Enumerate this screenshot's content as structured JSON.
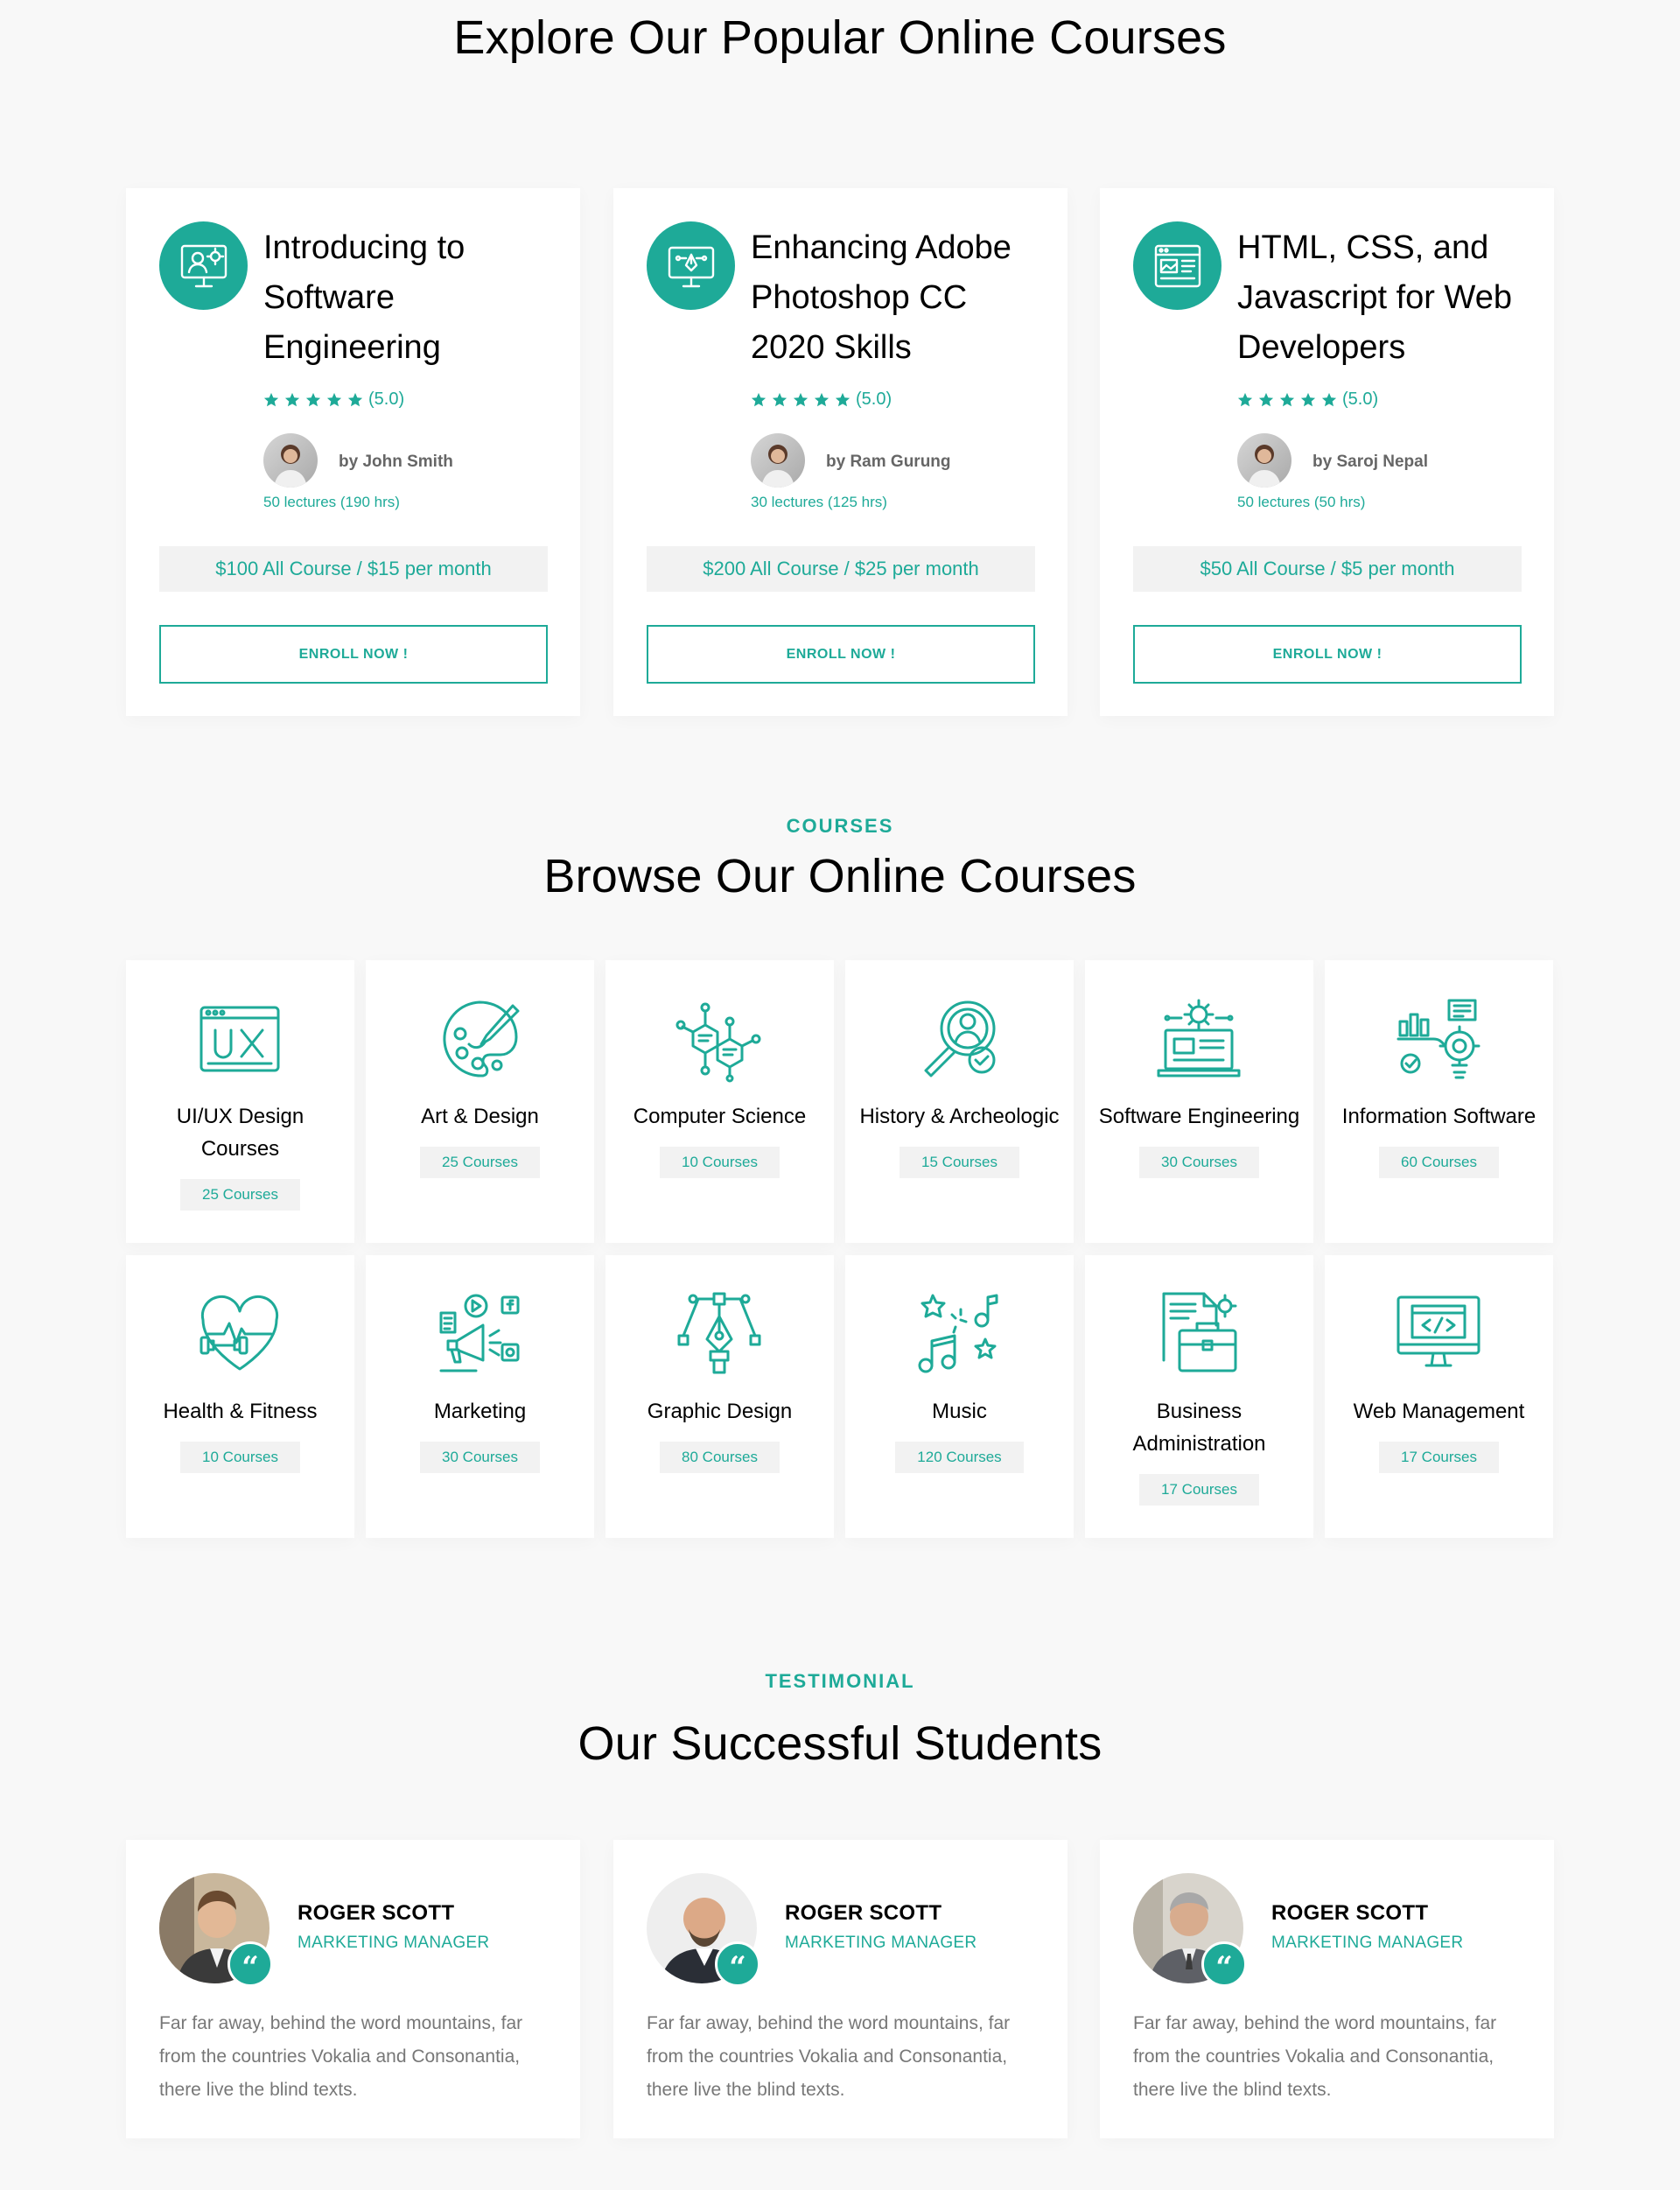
{
  "popular": {
    "title": "Explore Our Popular Online Courses",
    "enroll_label": "ENROLL NOW !",
    "courses": [
      {
        "title": "Introducing to Software Engineering",
        "rating": "(5.0)",
        "author": "by John Smith",
        "lectures": "50 lectures (190 hrs)",
        "price": "$100 All Course / $15 per month",
        "icon": "engineer-gear-icon"
      },
      {
        "title": "Enhancing Adobe Photoshop CC 2020 Skills",
        "rating": "(5.0)",
        "author": "by Ram Gurung",
        "lectures": "30 lectures (125 hrs)",
        "price": "$200 All Course / $25 per month",
        "icon": "monitor-pen-tool-icon"
      },
      {
        "title": "HTML, CSS, and Javascript for Web Developers",
        "rating": "(5.0)",
        "author": "by Saroj Nepal",
        "lectures": "50 lectures (50 hrs)",
        "price": "$50 All Course / $5 per month",
        "icon": "web-layout-icon"
      }
    ]
  },
  "browse": {
    "subtitle": "COURSES",
    "title": "Browse Our Online Courses",
    "categories": [
      {
        "name": "UI/UX Design Courses",
        "count": "25 Courses",
        "icon": "ux-window-icon"
      },
      {
        "name": "Art & Design",
        "count": "25 Courses",
        "icon": "palette-icon"
      },
      {
        "name": "Computer Science",
        "count": "10 Courses",
        "icon": "hexagon-network-icon"
      },
      {
        "name": "History & Archeologic",
        "count": "15 Courses",
        "icon": "magnifier-person-icon"
      },
      {
        "name": "Software Engineering",
        "count": "30 Courses",
        "icon": "laptop-gear-icon"
      },
      {
        "name": "Information Software",
        "count": "60 Courses",
        "icon": "chart-bulb-icon"
      },
      {
        "name": "Health & Fitness",
        "count": "10 Courses",
        "icon": "heart-dumbbell-icon"
      },
      {
        "name": "Marketing",
        "count": "30 Courses",
        "icon": "megaphone-social-icon"
      },
      {
        "name": "Graphic Design",
        "count": "80 Courses",
        "icon": "pen-tool-icon"
      },
      {
        "name": "Music",
        "count": "120 Courses",
        "icon": "music-notes-icon"
      },
      {
        "name": "Business Administration",
        "count": "17 Courses",
        "icon": "briefcase-document-icon"
      },
      {
        "name": "Web Management",
        "count": "17 Courses",
        "icon": "monitor-code-icon"
      }
    ]
  },
  "testimonial": {
    "subtitle": "TESTIMONIAL",
    "title": "Our Successful Students",
    "items": [
      {
        "name": "ROGER SCOTT",
        "role": "MARKETING MANAGER",
        "text": "Far far away, behind the word mountains, far from the countries Vokalia and Consonantia, there live the blind texts."
      },
      {
        "name": "ROGER SCOTT",
        "role": "MARKETING MANAGER",
        "text": "Far far away, behind the word mountains, far from the countries Vokalia and Consonantia, there live the blind texts."
      },
      {
        "name": "ROGER SCOTT",
        "role": "MARKETING MANAGER",
        "text": "Far far away, behind the word mountains, far from the countries Vokalia and Consonantia, there live the blind texts."
      }
    ]
  },
  "colors": {
    "accent": "#1eaa98",
    "background": "#f8f8f8",
    "card": "#ffffff",
    "chip": "#f2f2f2"
  }
}
